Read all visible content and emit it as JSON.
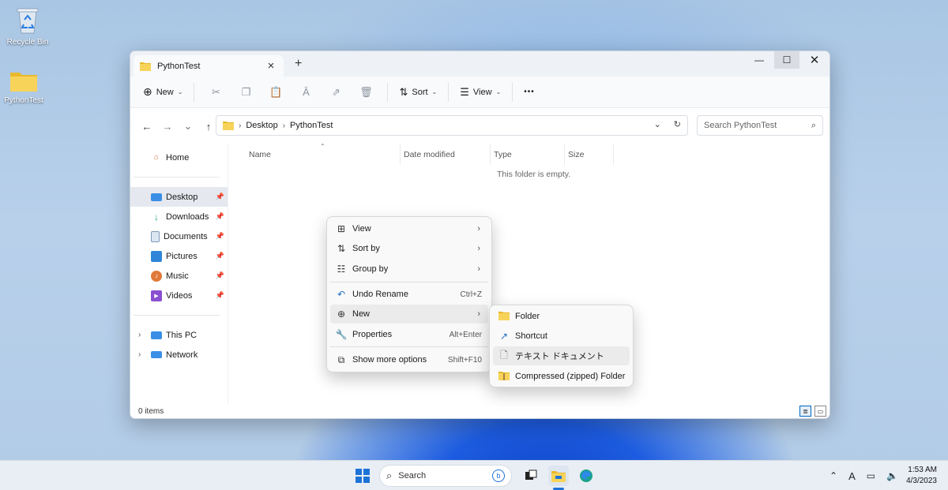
{
  "desktop": {
    "icons": [
      {
        "label": "Recycle Bin"
      },
      {
        "label": "PythonTest"
      }
    ]
  },
  "window": {
    "tab_title": "PythonTest",
    "toolbar": {
      "new_label": "New",
      "sort_label": "Sort",
      "view_label": "View",
      "more_label": "•••"
    },
    "address": {
      "crumbs": [
        "Desktop",
        "PythonTest"
      ],
      "search_placeholder": "Search PythonTest"
    },
    "sidebar": {
      "home": "Home",
      "pinned": [
        "Desktop",
        "Downloads",
        "Documents",
        "Pictures",
        "Music",
        "Videos"
      ],
      "this_pc": "This PC",
      "network": "Network"
    },
    "columns": [
      "Name",
      "Date modified",
      "Type",
      "Size"
    ],
    "empty_message": "This folder is empty.",
    "status": "0 items"
  },
  "context_menu": {
    "items": [
      {
        "label": "View"
      },
      {
        "label": "Sort by"
      },
      {
        "label": "Group by"
      },
      {
        "label": "Undo Rename",
        "shortcut": "Ctrl+Z"
      },
      {
        "label": "New"
      },
      {
        "label": "Properties",
        "shortcut": "Alt+Enter"
      },
      {
        "label": "Show more options",
        "shortcut": "Shift+F10"
      }
    ]
  },
  "submenu": {
    "items": [
      {
        "label": "Folder"
      },
      {
        "label": "Shortcut"
      },
      {
        "label": "テキスト ドキュメント"
      },
      {
        "label": "Compressed (zipped) Folder"
      }
    ]
  },
  "taskbar": {
    "search_label": "Search",
    "time": "1:53 AM",
    "date": "4/3/2023",
    "ime": "A"
  }
}
